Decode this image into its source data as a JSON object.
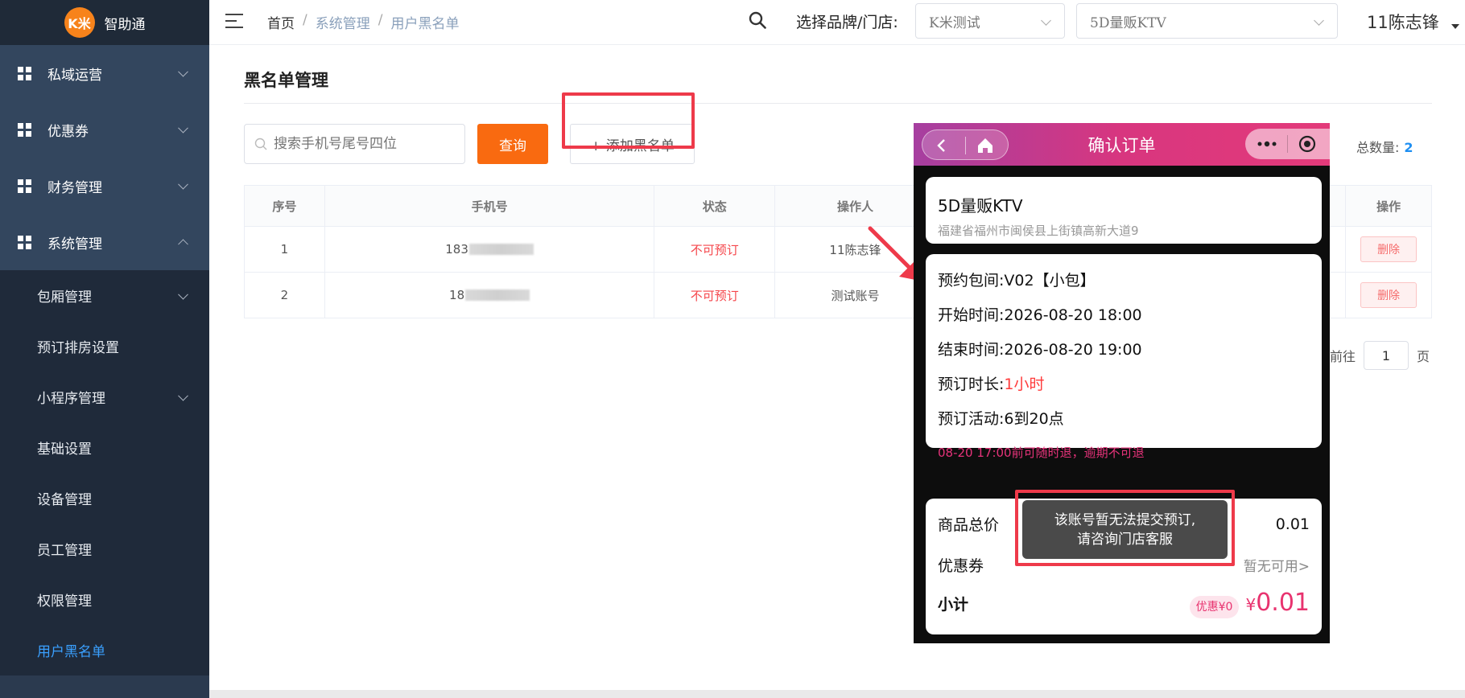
{
  "app": {
    "logo_badge": "K米",
    "name": "智助通"
  },
  "sidebar": {
    "groups": [
      {
        "label": "私域运营"
      },
      {
        "label": "优惠券"
      },
      {
        "label": "财务管理"
      },
      {
        "label": "系统管理"
      }
    ],
    "sub_items": [
      {
        "label": "包厢管理"
      },
      {
        "label": "预订排房设置"
      },
      {
        "label": "小程序管理"
      },
      {
        "label": "基础设置"
      },
      {
        "label": "设备管理"
      },
      {
        "label": "员工管理"
      },
      {
        "label": "权限管理"
      },
      {
        "label": "用户黑名单"
      }
    ]
  },
  "header": {
    "breadcrumb": {
      "home": "首页",
      "sep": "/",
      "level1": "系统管理",
      "level2": "用户黑名单"
    },
    "brand_label": "选择品牌/门店:",
    "brand_select": "K米测试",
    "store_select": "5D量贩KTV",
    "user": "11陈志锋"
  },
  "main": {
    "title": "黑名单管理",
    "search_placeholder": "搜索手机号尾号四位",
    "query_button": "查询",
    "add_button": "+ 添加黑名单",
    "total_label": "总数量:",
    "total_value": "2",
    "table": {
      "headers": [
        "序号",
        "手机号",
        "状态",
        "操作人",
        "",
        "操作"
      ],
      "rows": [
        {
          "index": "1",
          "phone_prefix": "183",
          "status": "不可预订",
          "operator": "11陈志锋",
          "action": "删除"
        },
        {
          "index": "2",
          "phone_prefix": "18",
          "status": "不可预订",
          "operator": "测试账号",
          "action": "删除"
        }
      ]
    },
    "pager": {
      "goto": "前往",
      "page": "1",
      "page_suffix": "页"
    }
  },
  "phone": {
    "title": "确认订单",
    "store_name": "5D量贩KTV",
    "store_addr": "福建省福州市闽侯县上街镇高新大道9",
    "room": {
      "label": "预约包间:",
      "value": "V02【小包】"
    },
    "start": {
      "label": "开始时间:",
      "value": "2026-08-20 18:00"
    },
    "end": {
      "label": "结束时间:",
      "value": "2026-08-20 19:00"
    },
    "duration": {
      "label": "预订时长:",
      "value": "1小时"
    },
    "activity": {
      "label": "预订活动:",
      "value": "6到20点"
    },
    "refund_note": "08-20 17:00前可随时退，逾期不可退",
    "total_label": "商品总价",
    "total_value": "0.01",
    "coupon_label": "优惠券",
    "coupon_value": "暂无可用>",
    "subtotal_label": "小计",
    "discount_badge": "优惠¥0",
    "currency": "¥",
    "subtotal_value": "0.01",
    "toast_line1": "该账号暂无法提交预订,",
    "toast_line2": "请咨询门店客服"
  },
  "colors": {
    "accent_orange": "#f96a10",
    "highlight_red": "#ee3a4a",
    "active_blue": "#3aa0ff",
    "brand_pink": "#e8336f"
  }
}
